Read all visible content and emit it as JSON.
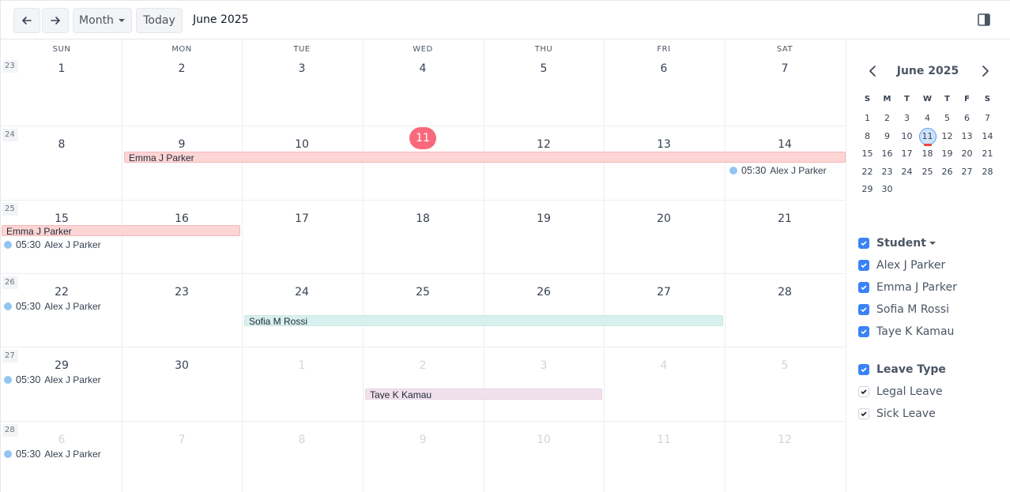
{
  "toolbar": {
    "prev_icon": "arrow-left-icon",
    "next_icon": "arrow-right-icon",
    "view_label": "Month",
    "today_label": "Today",
    "title": "June 2025",
    "sidebar_toggle_icon": "sidebar-toggle-icon"
  },
  "calendar": {
    "weekdays": [
      "SUN",
      "MON",
      "TUE",
      "WED",
      "THU",
      "FRI",
      "SAT"
    ],
    "weeks": [
      {
        "number": "23",
        "days": [
          "1",
          "2",
          "3",
          "4",
          "5",
          "6",
          "7"
        ],
        "other": [
          false,
          false,
          false,
          false,
          false,
          false,
          false
        ]
      },
      {
        "number": "24",
        "days": [
          "8",
          "9",
          "10",
          "11",
          "12",
          "13",
          "14"
        ],
        "other": [
          false,
          false,
          false,
          false,
          false,
          false,
          false
        ]
      },
      {
        "number": "25",
        "days": [
          "15",
          "16",
          "17",
          "18",
          "19",
          "20",
          "21"
        ],
        "other": [
          false,
          false,
          false,
          false,
          false,
          false,
          false
        ]
      },
      {
        "number": "26",
        "days": [
          "22",
          "23",
          "24",
          "25",
          "26",
          "27",
          "28"
        ],
        "other": [
          false,
          false,
          false,
          false,
          false,
          false,
          false
        ]
      },
      {
        "number": "27",
        "days": [
          "29",
          "30",
          "1",
          "2",
          "3",
          "4",
          "5"
        ],
        "other": [
          false,
          false,
          true,
          true,
          true,
          true,
          true
        ]
      },
      {
        "number": "28",
        "days": [
          "6",
          "7",
          "8",
          "9",
          "10",
          "11",
          "12"
        ],
        "other": [
          true,
          true,
          true,
          true,
          true,
          true,
          true
        ]
      }
    ],
    "today": "11",
    "events": {
      "emma_week24": "Emma J Parker",
      "emma_week25": "Emma J Parker",
      "sofia_week26": "Sofia M Rossi",
      "taye_week27": "Taye K Kamau",
      "alex_time": "05:30",
      "alex_name": "Alex J Parker"
    },
    "colors": {
      "today": "#f86a7b",
      "emma": "#fdd5d5",
      "sofia": "#d8f0ee",
      "taye": "#f0e1ec",
      "alex_dot": "#93c5f3"
    }
  },
  "sidebar": {
    "mini_title": "June 2025",
    "mini_weekdays": [
      "S",
      "M",
      "T",
      "W",
      "T",
      "F",
      "S"
    ],
    "mini_days": [
      [
        "1",
        "2",
        "3",
        "4",
        "5",
        "6",
        "7"
      ],
      [
        "8",
        "9",
        "10",
        "11",
        "12",
        "13",
        "14"
      ],
      [
        "15",
        "16",
        "17",
        "18",
        "19",
        "20",
        "21"
      ],
      [
        "22",
        "23",
        "24",
        "25",
        "26",
        "27",
        "28"
      ],
      [
        "29",
        "30",
        "",
        "",
        "",
        "",
        ""
      ]
    ],
    "student_heading": "Student",
    "students": [
      "Alex J Parker",
      "Emma J Parker",
      "Sofia M Rossi",
      "Taye K Kamau"
    ],
    "leave_heading": "Leave Type",
    "leave_types": [
      "Legal Leave",
      "Sick Leave"
    ]
  }
}
